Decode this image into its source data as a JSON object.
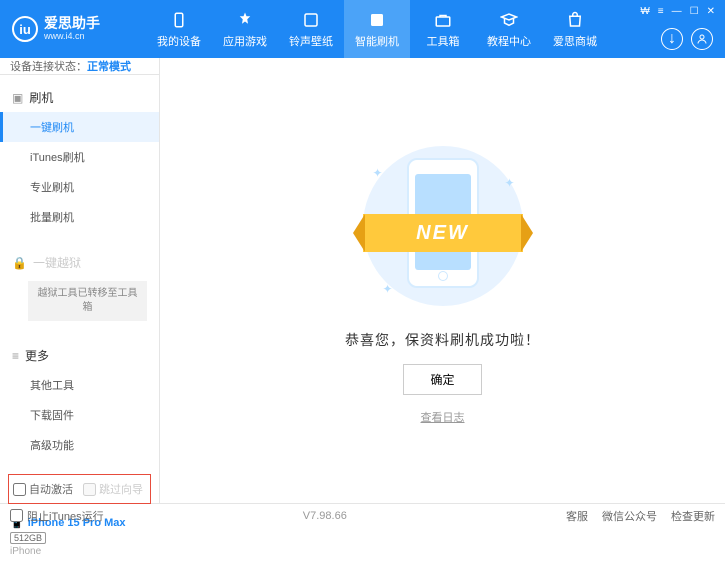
{
  "header": {
    "logo_title": "爱思助手",
    "logo_url": "www.i4.cn",
    "nav": [
      {
        "label": "我的设备"
      },
      {
        "label": "应用游戏"
      },
      {
        "label": "铃声壁纸"
      },
      {
        "label": "智能刷机"
      },
      {
        "label": "工具箱"
      },
      {
        "label": "教程中心"
      },
      {
        "label": "爱思商城"
      }
    ],
    "window_controls": [
      "⚙",
      "≡",
      "—",
      "☐",
      "✕"
    ]
  },
  "status": {
    "label": "设备连接状态：",
    "value": "正常模式"
  },
  "sidebar": {
    "section1": {
      "title": "刷机",
      "items": [
        "一键刷机",
        "iTunes刷机",
        "专业刷机",
        "批量刷机"
      ]
    },
    "section2": {
      "title": "一键越狱",
      "boxed": "越狱工具已转移至工具箱"
    },
    "section3": {
      "title": "更多",
      "items": [
        "其他工具",
        "下载固件",
        "高级功能"
      ]
    },
    "checks": {
      "auto_activate": "自动激活",
      "skip_guide": "跳过向导"
    },
    "device": {
      "name": "iPhone 15 Pro Max",
      "storage": "512GB",
      "type": "iPhone"
    }
  },
  "main": {
    "banner": "NEW",
    "success": "恭喜您，保资料刷机成功啦！",
    "ok_btn": "确定",
    "log_link": "查看日志"
  },
  "footer": {
    "block_itunes": "阻止iTunes运行",
    "version": "V7.98.66",
    "links": [
      "客服",
      "微信公众号",
      "检查更新"
    ]
  }
}
